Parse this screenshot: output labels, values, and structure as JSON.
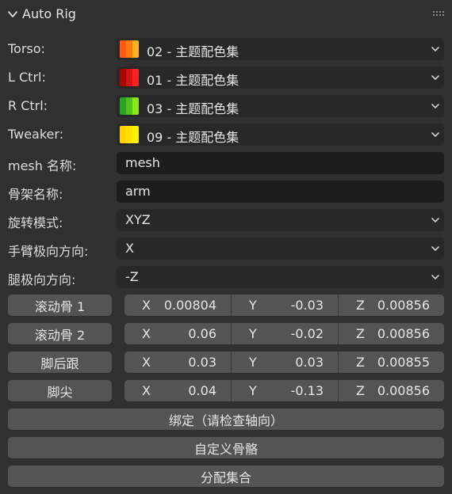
{
  "panel": {
    "title": "Auto Rig"
  },
  "color_rows": [
    {
      "label": "Torso:",
      "value": "02 - 主题配色集",
      "swatch": [
        "#ff5a1e",
        "#ff7a10",
        "#ffb020"
      ]
    },
    {
      "label": "L Ctrl:",
      "value": "01 - 主题配色集",
      "swatch": [
        "#a20a0a",
        "#d11414",
        "#ff2222"
      ]
    },
    {
      "label": "R Ctrl:",
      "value": "03 - 主题配色集",
      "swatch": [
        "#2aa12a",
        "#4fc21e",
        "#88e81a"
      ]
    },
    {
      "label": "Tweaker:",
      "value": "09 - 主题配色集",
      "swatch": [
        "#ffd200",
        "#ffe000",
        "#fff200"
      ]
    }
  ],
  "text_fields": [
    {
      "label": "mesh 名称:",
      "value": "mesh"
    },
    {
      "label": "骨架名称:",
      "value": "arm"
    }
  ],
  "dropdowns": [
    {
      "label": "旋转模式:",
      "value": "XYZ"
    },
    {
      "label": "手臂极向方向:",
      "value": "X"
    },
    {
      "label": "腿极向方向:",
      "value": "-Z"
    }
  ],
  "vectors": [
    {
      "button": "滚动骨 1",
      "x": "0.00804",
      "y": "-0.03",
      "z": "0.00856"
    },
    {
      "button": "滚动骨 2",
      "x": "0.06",
      "y": "-0.02",
      "z": "0.00856"
    },
    {
      "button": "脚后跟",
      "x": "0.03",
      "y": "0.03",
      "z": "0.00855"
    },
    {
      "button": "脚尖",
      "x": "0.04",
      "y": "-0.13",
      "z": "0.00856"
    }
  ],
  "axis_labels": {
    "x": "X",
    "y": "Y",
    "z": "Z"
  },
  "actions": {
    "bind": "绑定（请检查轴向）",
    "custom": "自定义骨骼",
    "assign": "分配集合"
  }
}
